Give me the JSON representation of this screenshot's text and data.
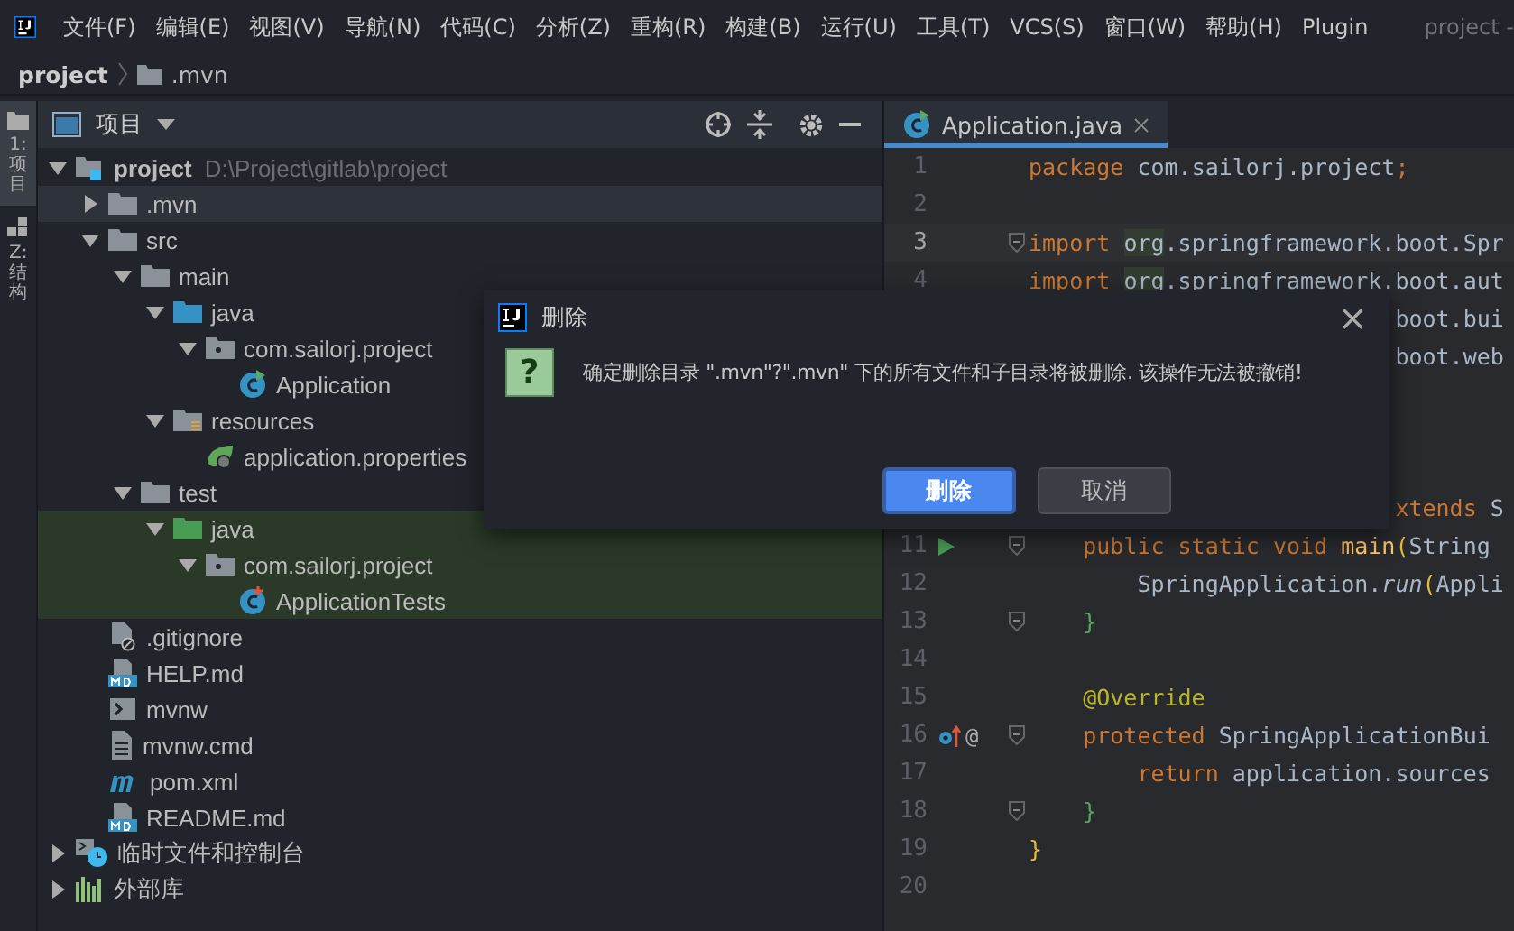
{
  "menu": {
    "items": [
      "文件(F)",
      "编辑(E)",
      "视图(V)",
      "导航(N)",
      "代码(C)",
      "分析(Z)",
      "重构(R)",
      "构建(B)",
      "运行(U)",
      "工具(T)",
      "VCS(S)",
      "窗口(W)",
      "帮助(H)",
      "Plugin"
    ],
    "title": "project -"
  },
  "breadcrumb": [
    {
      "label": "project",
      "kind": "project"
    },
    {
      "label": ".mvn",
      "kind": "folder"
    }
  ],
  "side_tabs": [
    {
      "label": "1: 项目",
      "selected": true
    },
    {
      "label": "Z: 结构",
      "selected": false
    }
  ],
  "project_panel": {
    "title": "项目",
    "tree": [
      {
        "label": "project",
        "path": "D:\\Project\\gitlab\\project",
        "kind": "module",
        "expanded": true,
        "selected": false,
        "highlighted": false,
        "children": [
          {
            "label": ".mvn",
            "kind": "folder",
            "expanded": false,
            "selected": true,
            "highlighted": false
          },
          {
            "label": "src",
            "kind": "folder",
            "expanded": true,
            "selected": false,
            "highlighted": false,
            "children": [
              {
                "label": "main",
                "kind": "folder",
                "expanded": true,
                "selected": false,
                "highlighted": false,
                "children": [
                  {
                    "label": "java",
                    "kind": "source",
                    "expanded": true,
                    "selected": false,
                    "highlighted": false,
                    "children": [
                      {
                        "label": "com.sailorj.project",
                        "kind": "package",
                        "expanded": true,
                        "selected": false,
                        "highlighted": false,
                        "children": [
                          {
                            "label": "Application",
                            "kind": "spring-class",
                            "selected": false,
                            "highlighted": false
                          }
                        ]
                      }
                    ]
                  },
                  {
                    "label": "resources",
                    "kind": "resources",
                    "expanded": true,
                    "selected": false,
                    "highlighted": false,
                    "children": [
                      {
                        "label": "application.properties",
                        "kind": "properties",
                        "selected": false,
                        "highlighted": false
                      }
                    ]
                  }
                ]
              },
              {
                "label": "test",
                "kind": "folder",
                "expanded": true,
                "selected": false,
                "highlighted": false,
                "children": [
                  {
                    "label": "java",
                    "kind": "test-source",
                    "expanded": true,
                    "selected": false,
                    "highlighted": true,
                    "children": [
                      {
                        "label": "com.sailorj.project",
                        "kind": "package",
                        "expanded": true,
                        "selected": false,
                        "highlighted": true,
                        "children": [
                          {
                            "label": "ApplicationTests",
                            "kind": "test-class",
                            "selected": false,
                            "highlighted": true
                          }
                        ]
                      }
                    ]
                  }
                ]
              }
            ]
          },
          {
            "label": ".gitignore",
            "kind": "ignore",
            "selected": false,
            "highlighted": false
          },
          {
            "label": "HELP.md",
            "kind": "markdown",
            "selected": false,
            "highlighted": false
          },
          {
            "label": "mvnw",
            "kind": "shell",
            "selected": false,
            "highlighted": false
          },
          {
            "label": "mvnw.cmd",
            "kind": "text",
            "selected": false,
            "highlighted": false
          },
          {
            "label": "pom.xml",
            "kind": "maven",
            "selected": false,
            "highlighted": false
          },
          {
            "label": "README.md",
            "kind": "markdown",
            "selected": false,
            "highlighted": false
          }
        ]
      },
      {
        "label": "临时文件和控制台",
        "kind": "scratch",
        "expanded": false,
        "selected": false,
        "highlighted": false
      },
      {
        "label": "外部库",
        "kind": "library",
        "expanded": false,
        "selected": false,
        "highlighted": false
      }
    ]
  },
  "editor": {
    "tabs": [
      {
        "label": "Application.java",
        "selected": true
      }
    ],
    "lines": [
      {
        "kind": "line",
        "number": "1",
        "tokens": [
          {
            "text": "package ",
            "kind": "keyword"
          },
          {
            "text": "com.sailorj.project",
            "kind": "plain"
          },
          {
            "text": ";",
            "kind": "keyword"
          }
        ]
      },
      {
        "kind": "line",
        "number": "2"
      },
      {
        "kind": "line",
        "number": "3",
        "current": true,
        "fold": true,
        "tokens": [
          {
            "text": "import ",
            "kind": "keyword"
          },
          {
            "text": "org",
            "kind": "unused"
          },
          {
            "text": ".springframework.boot.Spr",
            "kind": "plain"
          }
        ]
      },
      {
        "kind": "line",
        "number": "4",
        "tokens": [
          {
            "text": "import ",
            "kind": "keyword"
          },
          {
            "text": "org",
            "kind": "unused"
          },
          {
            "text": ".springframework.boot.aut",
            "kind": "plain"
          }
        ]
      },
      {
        "kind": "clipped",
        "tokens": [
          {
            "text": "boot.bui",
            "kind": "plain"
          }
        ]
      },
      {
        "kind": "clipped",
        "tokens": [
          {
            "text": "boot.web",
            "kind": "plain"
          }
        ]
      },
      {
        "kind": "hidden"
      },
      {
        "kind": "hidden"
      },
      {
        "kind": "hidden"
      },
      {
        "kind": "clipped",
        "tokens": [
          {
            "text": "xtends ",
            "kind": "keyword"
          },
          {
            "text": "S",
            "kind": "plain"
          }
        ]
      },
      {
        "kind": "line",
        "number": "11",
        "run": true,
        "fold": true,
        "tokens": [
          {
            "text": "    public static void ",
            "kind": "keyword"
          },
          {
            "text": "main",
            "kind": "method"
          },
          {
            "text": "(",
            "kind": "brace"
          },
          {
            "text": "String",
            "kind": "plain"
          }
        ]
      },
      {
        "kind": "line",
        "number": "12",
        "tokens": [
          {
            "text": "        SpringApplication.",
            "kind": "plain"
          },
          {
            "text": "run",
            "kind": "italic"
          },
          {
            "text": "(",
            "kind": "brace"
          },
          {
            "text": "Appli",
            "kind": "plain"
          }
        ]
      },
      {
        "kind": "line",
        "number": "13",
        "fold": true,
        "tokens": [
          {
            "text": "    }",
            "kind": "brace-green"
          }
        ]
      },
      {
        "kind": "line",
        "number": "14"
      },
      {
        "kind": "line",
        "number": "15",
        "tokens": [
          {
            "text": "    @Override",
            "kind": "annotation"
          }
        ]
      },
      {
        "kind": "line",
        "number": "16",
        "override": true,
        "annotation_mark": "@",
        "fold": true,
        "tokens": [
          {
            "text": "    protected ",
            "kind": "keyword"
          },
          {
            "text": "SpringApplicationBui",
            "kind": "plain"
          }
        ]
      },
      {
        "kind": "line",
        "number": "17",
        "tokens": [
          {
            "text": "        return ",
            "kind": "keyword"
          },
          {
            "text": "application.sources",
            "kind": "plain"
          }
        ]
      },
      {
        "kind": "line",
        "number": "18",
        "fold": true,
        "tokens": [
          {
            "text": "    }",
            "kind": "brace-green"
          }
        ]
      },
      {
        "kind": "line",
        "number": "19",
        "tokens": [
          {
            "text": "}",
            "kind": "brace"
          }
        ]
      },
      {
        "kind": "line",
        "number": "20"
      }
    ]
  },
  "dialog": {
    "title": "删除",
    "icon_glyph": "?",
    "message": "确定删除目录 \".mvn\"?\".mvn\" 下的所有文件和子目录将被删除. 该操作无法被撤销!",
    "close": "×",
    "buttons": [
      {
        "label": "删除",
        "default": true
      },
      {
        "label": "取消",
        "default": false
      }
    ]
  }
}
